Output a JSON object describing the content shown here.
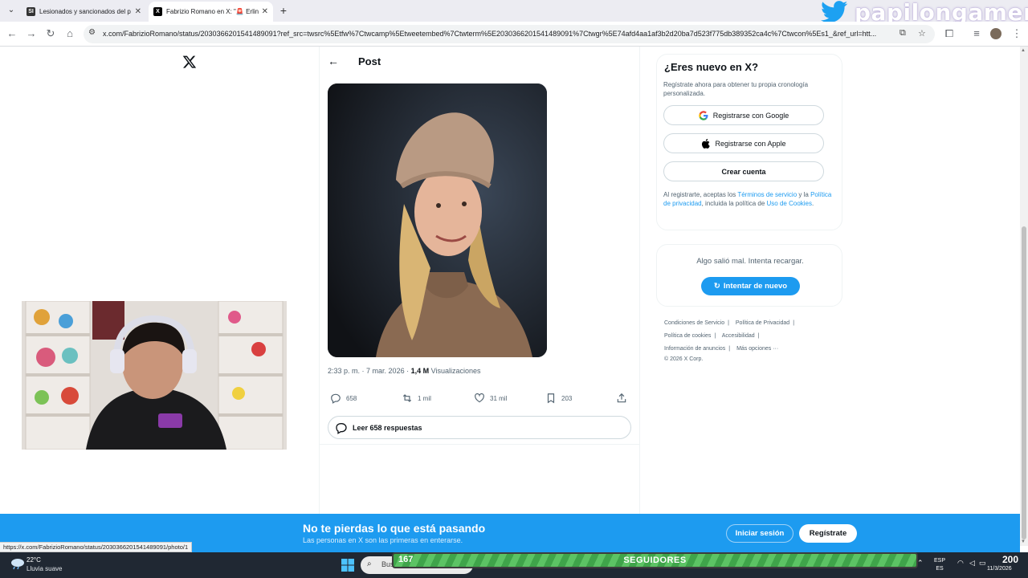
{
  "browser": {
    "tabs": [
      {
        "title": "Lesionados y sancionados del p",
        "favicon": "SI",
        "active": false
      },
      {
        "title": "Fabrizio Romano en X: \"🚨 Erlin",
        "favicon": "X",
        "active": true
      }
    ],
    "url": "x.com/FabrizioRomano/status/2030366201541489091?ref_src=twsrc%5Etfw%7Ctwcamp%5Etweetembed%7Ctwterm%5E2030366201541489091%7Ctwgr%5E74afd4aa1af3b2d20ba7d523f775db389352ca4c%7Ctwcon%5Es1_&ref_url=htt..."
  },
  "brand": {
    "text": "papilongamer"
  },
  "post": {
    "header": "Post",
    "time": "2:33 p. m.",
    "date": "7 mar. 2026",
    "views_count": "1,4 M",
    "views_label": "Visualizaciones",
    "replies": "658",
    "reposts": "1 mil",
    "likes": "31 mil",
    "bookmarks": "203",
    "read_replies": "Leer 658 respuestas"
  },
  "signup": {
    "title": "¿Eres nuevo en X?",
    "subtitle": "Regístrate ahora para obtener tu propia cronología personalizada.",
    "google": "Registrarse con Google",
    "apple": "Registrarse con Apple",
    "create": "Crear cuenta",
    "legal_1": "Al registrarte, aceptas los ",
    "terms": "Términos de servicio",
    "legal_2": " y la ",
    "privacy": "Política de privacidad",
    "legal_3": ", incluida la política de ",
    "cookies": "Uso de Cookies",
    "legal_4": "."
  },
  "error": {
    "message": "Algo salió mal. Intenta recargar.",
    "retry": "Intentar de nuevo"
  },
  "footer": {
    "terms": "Condiciones de Servicio",
    "privacy": "Política de Privacidad",
    "cookies": "Política de cookies",
    "accessibility": "Accesibilidad",
    "ads": "Información de anuncios",
    "more": "Más opciones ···",
    "copyright": "© 2026 X Corp."
  },
  "banner": {
    "title": "No te pierdas lo que está pasando",
    "subtitle": "Las personas en X son las primeras en enterarse.",
    "login": "Iniciar sesión",
    "register": "Regístrate"
  },
  "status_url": "https://x.com/FabrizioRomano/status/2030366201541489091/photo/1",
  "taskbar": {
    "temperature": "22°C",
    "weather": "Lluvia suave",
    "search": "Busc",
    "lang_1": "ESP",
    "lang_2": "ES",
    "date": "11/3/2026"
  },
  "followers_goal": {
    "current": "167",
    "label": "SEGUIDORES",
    "goal": "200"
  }
}
